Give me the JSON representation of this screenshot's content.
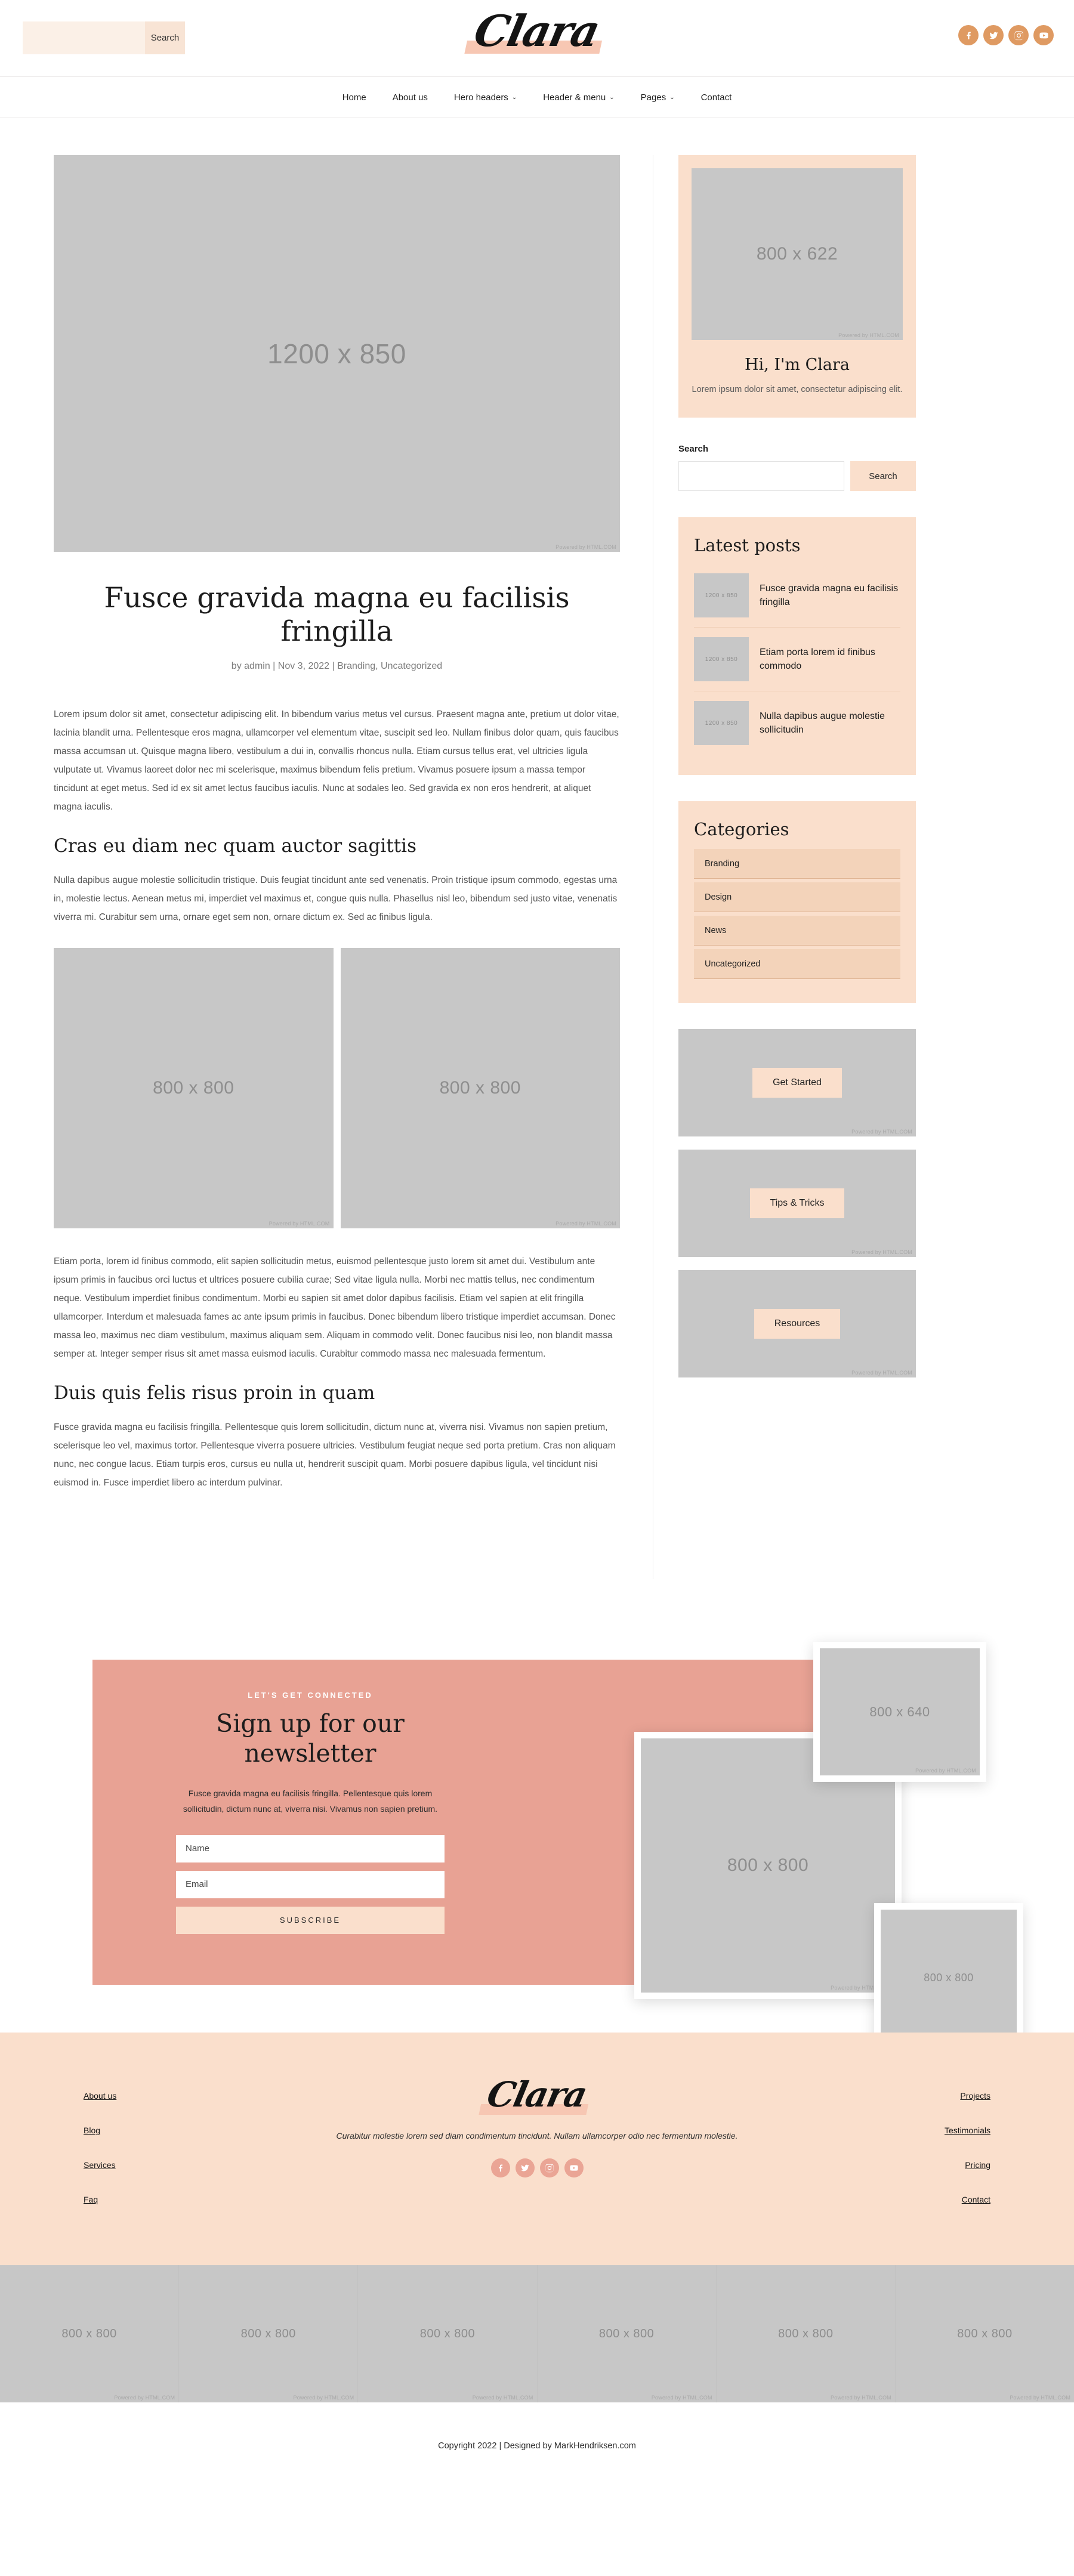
{
  "topbar": {
    "search_value": "",
    "search_placeholder": "",
    "search_button": "Search",
    "logo": "Clara",
    "social": [
      {
        "name": "facebook-icon",
        "label": "Facebook"
      },
      {
        "name": "twitter-icon",
        "label": "Twitter"
      },
      {
        "name": "instagram-icon",
        "label": "Instagram"
      },
      {
        "name": "youtube-icon",
        "label": "YouTube"
      }
    ]
  },
  "nav": {
    "items": [
      {
        "label": "Home",
        "has_dropdown": false
      },
      {
        "label": "About us",
        "has_dropdown": false
      },
      {
        "label": "Hero headers",
        "has_dropdown": true
      },
      {
        "label": "Header & menu",
        "has_dropdown": true
      },
      {
        "label": "Pages",
        "has_dropdown": true
      },
      {
        "label": "Contact",
        "has_dropdown": false
      }
    ],
    "caret": "⌄"
  },
  "article": {
    "featured_image": "1200 x 850",
    "powered": "Powered by HTML.COM",
    "title": "Fusce gravida magna eu facilisis fringilla",
    "meta": "by admin | Nov 3, 2022 | Branding, Uncategorized",
    "p1": "Lorem ipsum dolor sit amet, consectetur adipiscing elit. In bibendum varius metus vel cursus. Praesent magna ante, pretium ut dolor vitae, lacinia blandit urna. Pellentesque eros magna, ullamcorper vel elementum vitae, suscipit sed leo. Nullam finibus dolor quam, quis faucibus massa accumsan ut. Quisque magna libero, vestibulum a dui in, convallis rhoncus nulla. Etiam cursus tellus erat, vel ultricies ligula vulputate ut. Vivamus laoreet dolor nec mi scelerisque, maximus bibendum felis pretium. Vivamus posuere ipsum a massa tempor tincidunt at eget metus. Sed id ex sit amet lectus faucibus iaculis. Nunc at sodales leo. Sed gravida ex non eros hendrerit, at aliquet magna iaculis.",
    "h2_1": "Cras eu diam nec quam auctor sagittis",
    "p2": "Nulla dapibus augue molestie sollicitudin tristique. Duis feugiat tincidunt ante sed venenatis. Proin tristique ipsum commodo, egestas urna in, molestie lectus. Aenean metus mi, imperdiet vel maximus et, congue quis nulla. Phasellus nisl leo, bibendum sed justo vitae, venenatis viverra mi. Curabitur sem urna, ornare eget sem non, ornare dictum ex. Sed ac finibus ligula.",
    "image_left": "800 x 800",
    "image_right": "800 x 800",
    "p3": "Etiam porta, lorem id finibus commodo, elit sapien sollicitudin metus, euismod pellentesque justo lorem sit amet dui. Vestibulum ante ipsum primis in faucibus orci luctus et ultrices posuere cubilia curae; Sed vitae ligula nulla. Morbi nec mattis tellus, nec condimentum neque. Vestibulum imperdiet finibus condimentum. Morbi eu sapien sit amet dolor dapibus facilisis. Etiam vel sapien at elit fringilla ullamcorper. Interdum et malesuada fames ac ante ipsum primis in faucibus. Donec bibendum libero tristique imperdiet accumsan. Donec massa leo, maximus nec diam vestibulum, maximus aliquam sem. Aliquam in commodo velit. Donec faucibus nisi leo, non blandit massa semper at. Integer semper risus sit amet massa euismod iaculis. Curabitur commodo massa nec malesuada fermentum.",
    "h2_2": "Duis quis felis risus proin in quam",
    "p4": "Fusce gravida magna eu facilisis fringilla. Pellentesque quis lorem sollicitudin, dictum nunc at, viverra nisi. Vivamus non sapien pretium, scelerisque leo vel, maximus tortor. Pellentesque viverra posuere ultricies. Vestibulum feugiat neque sed porta pretium. Cras non aliquam nunc, nec congue lacus. Etiam turpis eros, cursus eu nulla ut, hendrerit suscipit quam. Morbi posuere dapibus ligula, vel tincidunt nisi euismod in. Fusce imperdiet libero ac interdum pulvinar."
  },
  "sidebar": {
    "about": {
      "image": "800 x 622",
      "powered": "Powered by HTML.COM",
      "title": "Hi, I'm Clara",
      "text": "Lorem ipsum dolor sit amet, consectetur adipiscing elit."
    },
    "search": {
      "heading": "Search",
      "value": "",
      "placeholder": "",
      "button": "Search"
    },
    "latest": {
      "heading": "Latest posts",
      "items": [
        {
          "thumb": "1200 x 850",
          "title": "Fusce gravida magna eu facilisis fringilla"
        },
        {
          "thumb": "1200 x 850",
          "title": "Etiam porta lorem id finibus commodo"
        },
        {
          "thumb": "1200 x 850",
          "title": "Nulla dapibus augue molestie sollicitudin"
        }
      ]
    },
    "categories": {
      "heading": "Categories",
      "items": [
        {
          "label": "Branding"
        },
        {
          "label": "Design"
        },
        {
          "label": "News"
        },
        {
          "label": "Uncategorized"
        }
      ]
    },
    "cta": [
      {
        "button": "Get Started",
        "powered": "Powered by HTML.COM"
      },
      {
        "button": "Tips & Tricks",
        "powered": "Powered by HTML.COM"
      },
      {
        "button": "Resources",
        "powered": "Powered by HTML.COM"
      }
    ]
  },
  "newsletter": {
    "eyebrow": "LET'S GET CONNECTED",
    "title": "Sign up for our newsletter",
    "description": "Fusce gravida magna eu facilisis fringilla. Pellentesque quis lorem sollicitudin, dictum nunc at, viverra nisi. Vivamus non sapien pretium.",
    "name_placeholder": "Name",
    "name_value": "",
    "email_placeholder": "Email",
    "email_value": "",
    "submit": "SUBSCRIBE",
    "image_main": "800 x 800",
    "image_top": "800 x 640",
    "image_bottom": "800 x 800",
    "powered": "Powered by HTML.COM"
  },
  "footer": {
    "left_links": [
      {
        "label": "About us"
      },
      {
        "label": "Blog"
      },
      {
        "label": "Services"
      },
      {
        "label": "Faq"
      }
    ],
    "right_links": [
      {
        "label": "Projects"
      },
      {
        "label": "Testimonials"
      },
      {
        "label": "Pricing"
      },
      {
        "label": "Contact"
      }
    ],
    "logo": "Clara",
    "tagline": "Curabitur molestie lorem sed diam condimentum tincidunt. Nullam ullamcorper odio nec fermentum molestie.",
    "social": [
      {
        "name": "facebook-icon",
        "label": "Facebook"
      },
      {
        "name": "twitter-icon",
        "label": "Twitter"
      },
      {
        "name": "instagram-icon",
        "label": "Instagram"
      },
      {
        "name": "youtube-icon",
        "label": "YouTube"
      }
    ],
    "gallery": [
      {
        "label": "800 x 800"
      },
      {
        "label": "800 x 800"
      },
      {
        "label": "800 x 800"
      },
      {
        "label": "800 x 800"
      },
      {
        "label": "800 x 800"
      },
      {
        "label": "800 x 800"
      }
    ],
    "gallery_powered": "Powered by HTML.COM",
    "copyright": "Copyright 2022 | Designed by MarkHendriksen.com"
  },
  "colors": {
    "peach_light": "#fadfcc",
    "peach_mid": "#f3d3ba",
    "salmon": "#e8a294",
    "orange_social": "#df9a62",
    "placeholder_grey": "#c7c7c7"
  }
}
